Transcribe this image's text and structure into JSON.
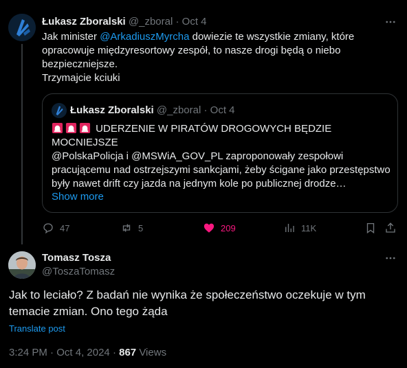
{
  "parent": {
    "author_name": "Łukasz Zboralski",
    "handle": "@_zboral",
    "separator": "·",
    "date": "Oct 4",
    "body_prefix": "Jak minister ",
    "mention": "@ArkadiuszMyrcha",
    "body_suffix": " dowiezie te wszystkie zmiany, które opracowuje międzyresortowy zespół, to nasze drogi będą o niebo bezpieczniejsze.",
    "body_line2": "Trzymajcie kciuki",
    "quote": {
      "author_name": "Łukasz Zboralski",
      "handle": "@_zboral",
      "separator": "·",
      "date": "Oct 4",
      "title": "UDERZENIE W PIRATÓW DROGOWYCH BĘDZIE MOCNIEJSZE",
      "body": "@PolskaPolicja i @MSWiA_GOV_PL zaproponowały zespołowi pracującemu nad ostrzejszymi sankcjami, żeby ścigane jako przestępstwo były nawet drift czy jazda na jednym kole po publicznej drodze…",
      "show_more": "Show more"
    },
    "actions": {
      "replies": "47",
      "reposts": "5",
      "likes": "209",
      "views": "11K"
    }
  },
  "reply": {
    "author_name": "Tomasz Tosza",
    "handle": "@ToszaTomasz",
    "body": "Jak to leciało? Z badań nie wynika że społeczeństwo oczekuje w tym temacie zmian. Ono tego żąda",
    "translate": "Translate post",
    "time": "3:24 PM",
    "separator": "·",
    "date": "Oct 4, 2024",
    "separator2": "·",
    "views_count": "867",
    "views_label": "Views"
  },
  "colors": {
    "background": "#000000",
    "text": "#e7e9ea",
    "muted": "#71767b",
    "link": "#1d9bf0",
    "like": "#f91880",
    "border": "#2f3336"
  },
  "icons": [
    "more-icon",
    "reply-icon",
    "repost-icon",
    "like-icon",
    "views-icon",
    "bookmark-icon",
    "share-icon",
    "siren-icon"
  ]
}
